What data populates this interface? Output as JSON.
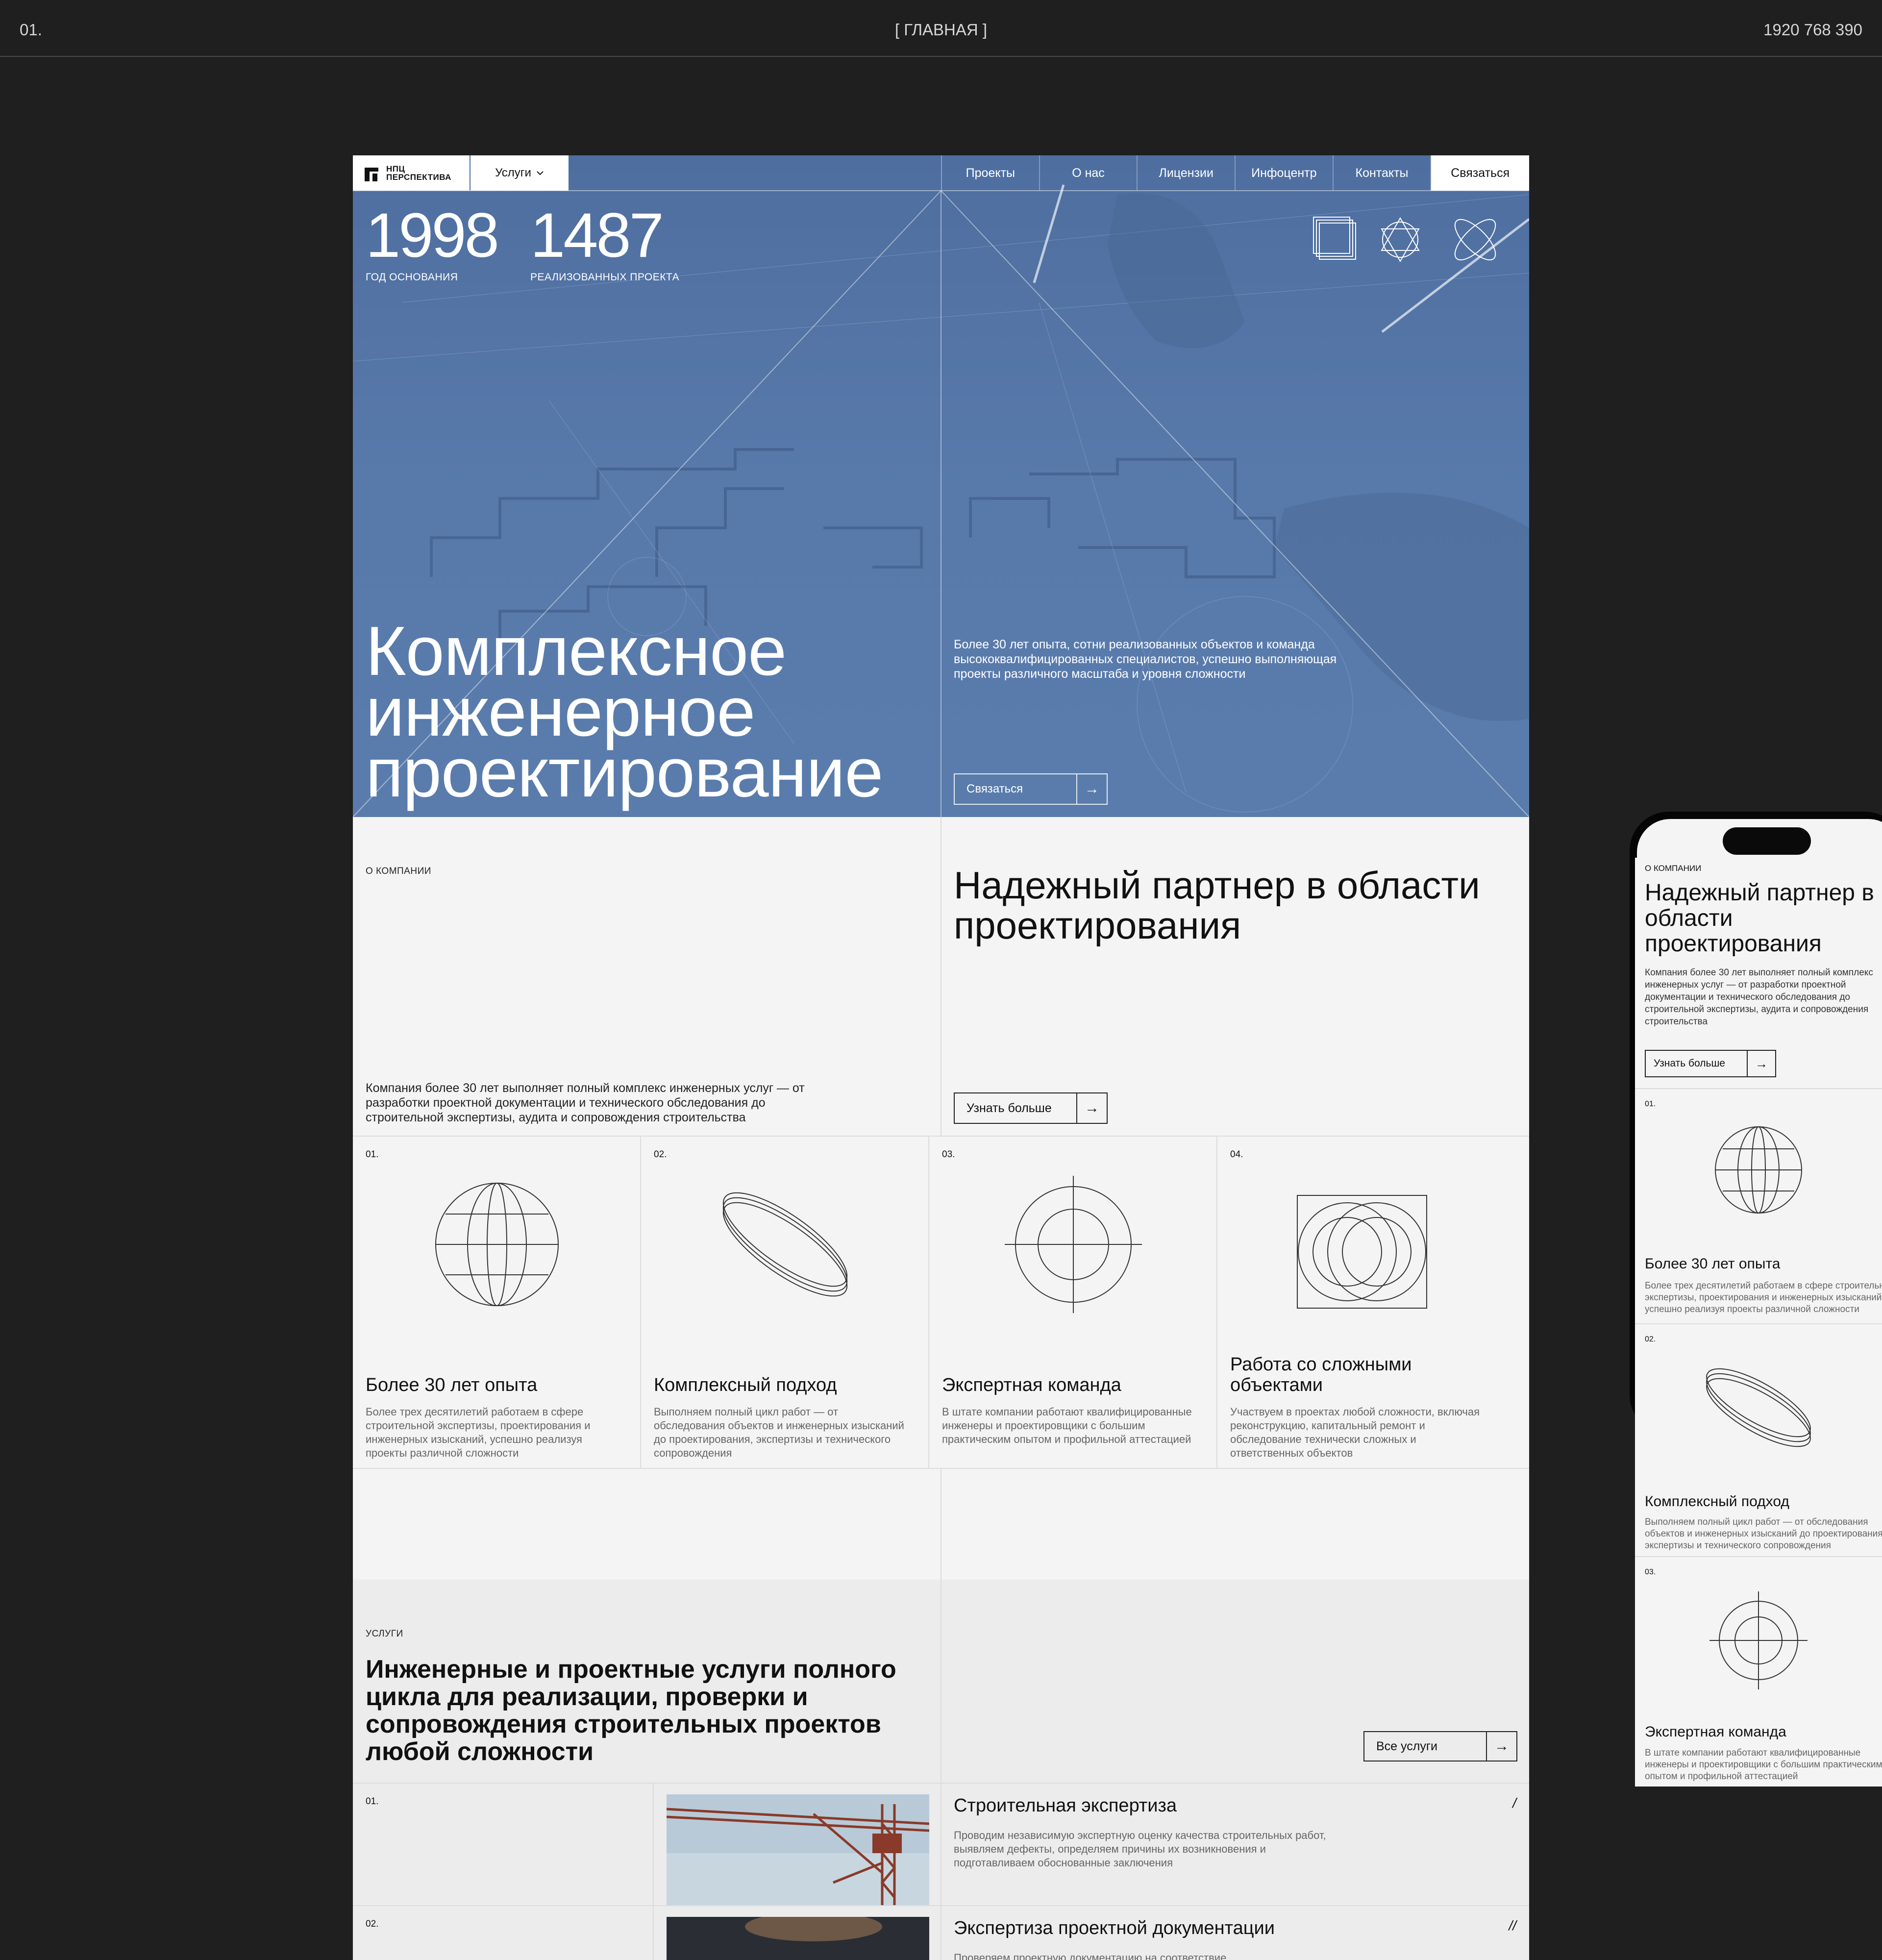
{
  "topbar": {
    "index": "01.",
    "title": "[ ГЛАВНАЯ ]",
    "sizes": "1920  768  390"
  },
  "nav": {
    "logo_line1": "НПЦ",
    "logo_line2": "ПЕРСПЕКТИВА",
    "services": "Услуги",
    "links": [
      "Проекты",
      "О нас",
      "Лицензии",
      "Инфоцентр",
      "Контакты"
    ],
    "cta": "Связаться"
  },
  "hero": {
    "stat1_value": "1998",
    "stat1_label": "ГОД ОСНОВАНИЯ",
    "stat2_value": "1487",
    "stat2_label": "РЕАЛИЗОВАННЫХ ПРОЕКТА",
    "title_line1": "Комплексное",
    "title_line2": "инженерное",
    "title_line3": "проектирование",
    "subtitle": "Более 30 лет опыта, сотни реализованных объектов и команда высококвалифицированных специалистов, успешно выполняющая проекты различного масштаба и уровня сложности",
    "button": "Связаться",
    "arrow": "→"
  },
  "about": {
    "label": "О КОМПАНИИ",
    "heading": "Надежный партнер в области проектирования",
    "text": "Компания более 30 лет выполняет полный комплекс инженерных услуг — от разработки проектной документации и технического обследования до строительной экспертизы, аудита и сопровождения строительства",
    "button": "Узнать больше",
    "arrow": "→"
  },
  "features": [
    {
      "num": "01.",
      "icon": "globe-icon",
      "title": "Более 30 лет опыта",
      "text": "Более трех десятилетий работаем в сфере строительной экспертизы, проектирования и инженерных изысканий, успешно реализуя проекты различной сложности"
    },
    {
      "num": "02.",
      "icon": "rings-icon",
      "title": "Комплексный подход",
      "text": "Выполняем полный цикл работ — от обследования объектов и инженерных изысканий до проектирования, экспертизы и технического сопровождения"
    },
    {
      "num": "03.",
      "icon": "target-icon",
      "title": "Экспертная команда",
      "text": "В штате компании работают квалифицированные инженеры и проектировщики с большим практическим опытом и профильной аттестацией"
    },
    {
      "num": "04.",
      "icon": "overlap-circles-icon",
      "title": "Работа со сложными объектами",
      "text": "Участвуем в проектах любой сложности, включая реконструкцию, капитальный ремонт и обследование технически сложных и ответственных объектов"
    }
  ],
  "services": {
    "label": "УСЛУГИ",
    "heading": "Инженерные и проектные услуги полного цикла для реализации, проверки и сопровождения строительных проектов любой сложности",
    "button": "Все услуги",
    "arrow": "→",
    "items": [
      {
        "num": "01.",
        "title": "Строительная экспертиза",
        "text": "Проводим независимую экспертную оценку качества строительных работ, выявляем дефекты, определяем причины их возникновения и подготавливаем обоснованные заключения",
        "mark": "/"
      },
      {
        "num": "02.",
        "title": "Экспертиза проектной документации",
        "text": "Проверяем проектную документацию на соответствие",
        "mark": "//"
      }
    ]
  },
  "mobile": {
    "label": "О КОМПАНИИ",
    "heading": "Надежный партнер в области проектирования",
    "text_lines": [
      "Компания более 30 лет выполняет полный комплекс",
      "инженерных услуг — от разработки проектной",
      "документации и технического обследования до",
      "строительной экспертизы, аудита и сопровождения",
      "строительства"
    ],
    "button": "Узнать больше",
    "arrow": "→",
    "cards": [
      {
        "num": "01.",
        "title": "Более 30 лет опыта",
        "lines": [
          "Более трех десятилетий работаем в сфере строительной",
          "экспертизы, проектирования и инженерных изысканий,",
          "успешно реализуя проекты различной сложности"
        ]
      },
      {
        "num": "02.",
        "title": "Комплексный подход",
        "lines": [
          "Выполняем полный цикл работ — от обследования",
          "объектов и инженерных изысканий до проектирования,",
          "экспертизы и технического сопровождения"
        ]
      },
      {
        "num": "03.",
        "title": "Экспертная команда",
        "lines": [
          "В штате компании работают квалифицированные",
          "инженеры и проектировщики с большим практическим",
          "опытом и профильной аттестацией"
        ]
      }
    ]
  }
}
